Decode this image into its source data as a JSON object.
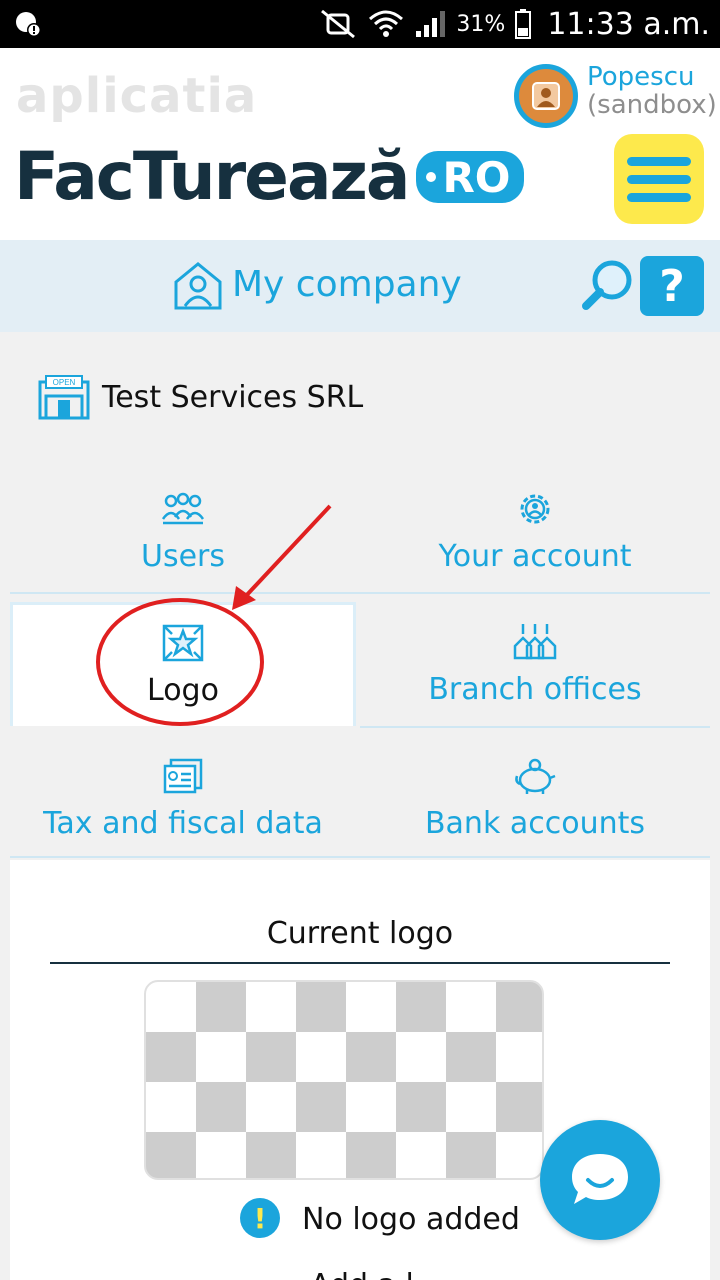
{
  "status_bar": {
    "battery": "31%",
    "time": "11:33 a.m."
  },
  "header": {
    "app_label": "aplicatia",
    "brand_name": "FacTurează",
    "brand_suffix": "RO",
    "user_name": "Popescu",
    "user_env": "(sandbox)"
  },
  "title_bar": {
    "title": "My company",
    "help_label": "?"
  },
  "company": {
    "name": "Test Services SRL",
    "icon_sign": "OPEN"
  },
  "tiles": [
    {
      "label": "Users",
      "icon": "users-icon"
    },
    {
      "label": "Your account",
      "icon": "gear-user-icon"
    },
    {
      "label": "Logo",
      "icon": "logo-star-icon"
    },
    {
      "label": "Branch offices",
      "icon": "branch-offices-icon"
    },
    {
      "label": "Tax and fiscal data",
      "icon": "fiscal-card-icon"
    },
    {
      "label": "Bank accounts",
      "icon": "piggy-bank-icon"
    }
  ],
  "panel": {
    "heading": "Current logo",
    "warning": "No logo added",
    "warning_mark": "!",
    "cut_text": "Add a l"
  },
  "colors": {
    "accent": "#1ba5dc",
    "dark": "#16303f",
    "yellow": "#fde94c",
    "annotation": "#e02020"
  }
}
